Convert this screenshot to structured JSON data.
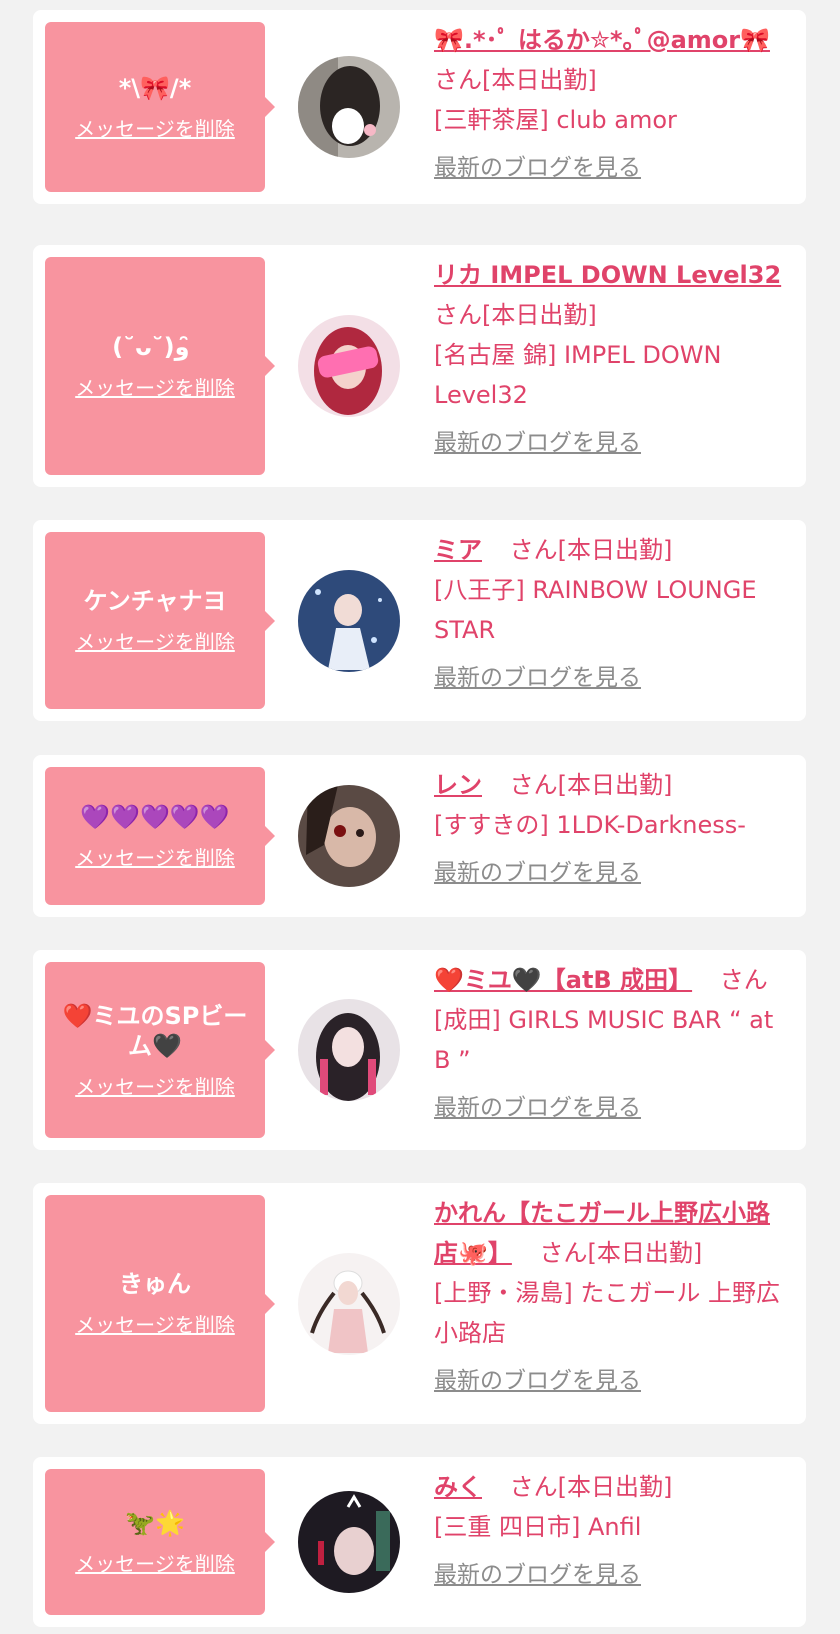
{
  "colors": {
    "accent": "#e0436a",
    "bubble": "#f8949f",
    "link_gray": "#8c8c8c",
    "bg": "#f2f2f2"
  },
  "entries": [
    {
      "message": "*\\🎀/*",
      "delete_label": "メッセージを削除",
      "name": "🎀.*･ﾟ はるか✮*｡ﾟ@amor🎀",
      "san": "さん[本日出勤]",
      "shop": "[三軒茶屋] club amor",
      "blog_label": "最新のブログを見る"
    },
    {
      "message": "(˘ᴗ˘)و ̑̑",
      "delete_label": "メッセージを削除",
      "name": "リカ IMPEL DOWN Level32",
      "san": "さん[本日出勤]",
      "shop": "[名古屋 錦] IMPEL DOWN Level32",
      "blog_label": "最新のブログを見る"
    },
    {
      "message": "ケンチャナヨ",
      "delete_label": "メッセージを削除",
      "name": "ミア",
      "san": "さん[本日出勤]",
      "shop": "[八王子] RAINBOW LOUNGE STAR",
      "blog_label": "最新のブログを見る"
    },
    {
      "message": "💜💜💜💜💜",
      "delete_label": "メッセージを削除",
      "name": "レン",
      "san": "さん[本日出勤]",
      "shop": "[すすきの] 1LDK-Darkness-",
      "blog_label": "最新のブログを見る"
    },
    {
      "message": "❤️ミユのSPビーム🖤",
      "delete_label": "メッセージを削除",
      "name": "❤️ミユ🖤【atB 成田】",
      "san": "さん",
      "shop": "[成田] GIRLS MUSIC BAR “ at B ”",
      "blog_label": "最新のブログを見る"
    },
    {
      "message": "きゅん",
      "delete_label": "メッセージを削除",
      "name": "かれん【たこガール上野広小路店🐙】",
      "san": "さん[本日出勤]",
      "shop": "[上野・湯島] たこガール 上野広小路店",
      "blog_label": "最新のブログを見る"
    },
    {
      "message": "🦖🌟",
      "delete_label": "メッセージを削除",
      "name": "みく",
      "san": "さん[本日出勤]",
      "shop": "[三重 四日市] Anfil",
      "blog_label": "最新のブログを見る"
    }
  ]
}
